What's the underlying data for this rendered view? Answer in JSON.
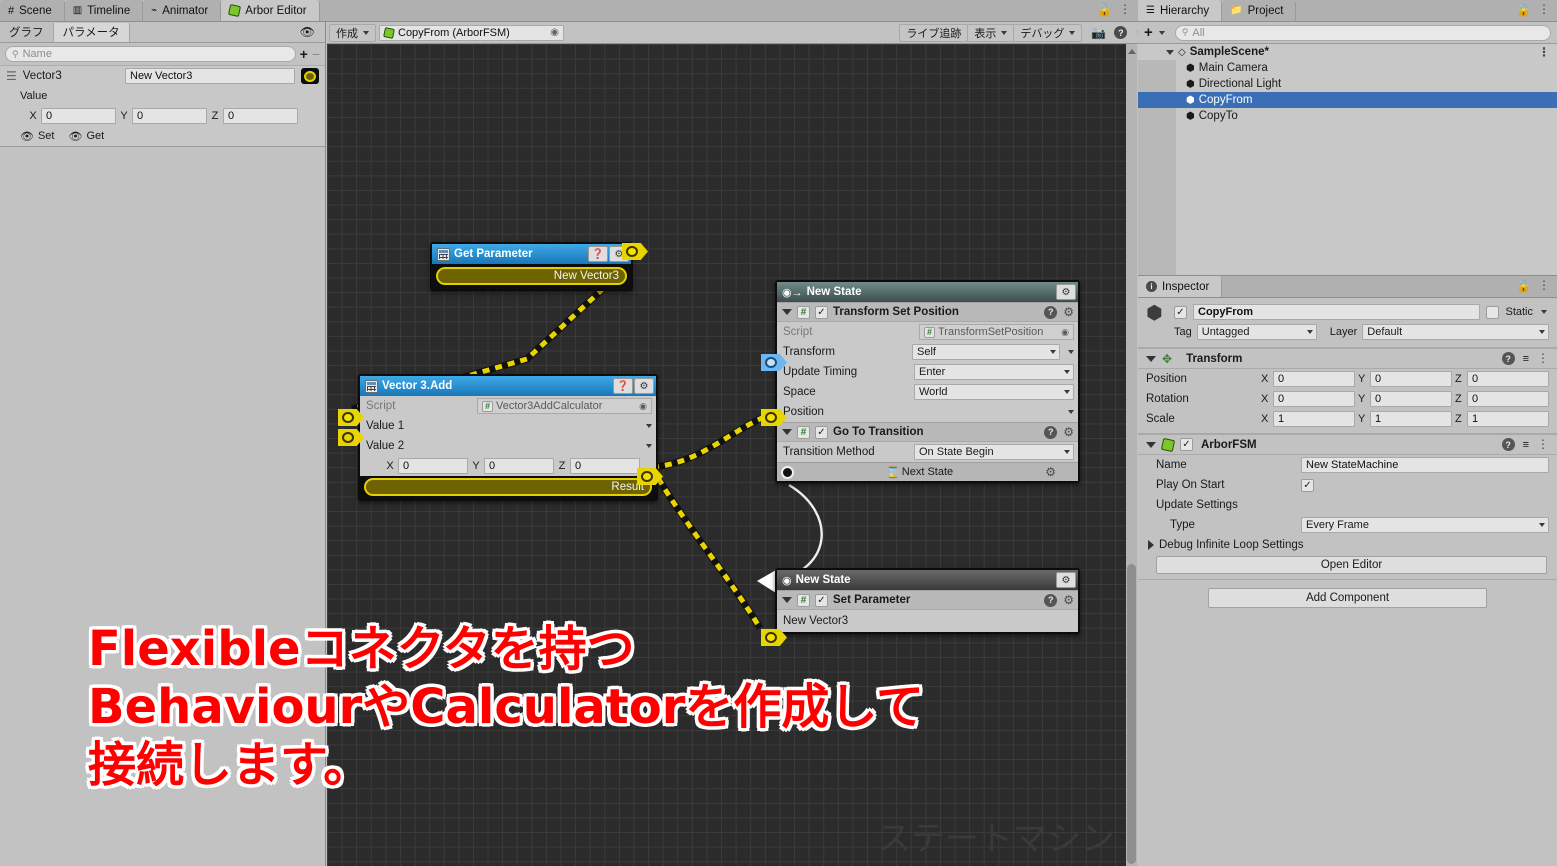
{
  "window": {
    "tabs": [
      {
        "label": "Scene",
        "icon": "grid-icon",
        "active": false
      },
      {
        "label": "Timeline",
        "icon": "film-icon",
        "active": false
      },
      {
        "label": "Animator",
        "icon": "animator-icon",
        "active": false
      },
      {
        "label": "Arbor Editor",
        "icon": "arbor-icon",
        "active": true
      }
    ],
    "lock_icon": "lock-icon",
    "menu_icon": "kebab-menu-icon"
  },
  "left_panel": {
    "tabs": [
      {
        "label": "グラフ",
        "active": false
      },
      {
        "label": "パラメータ",
        "active": true
      }
    ],
    "visibility_icon": "eye-icon",
    "search": {
      "placeholder": "Name",
      "icon": "search-icon"
    },
    "add_button": "+",
    "remove_button": "−",
    "parameter": {
      "drag_handle": "drag-handle-icon",
      "type": "Vector3",
      "name": "New Vector3",
      "connector_icon": "flexible-connector-icon",
      "value_label": "Value",
      "axes": [
        {
          "label": "X",
          "value": "0"
        },
        {
          "label": "Y",
          "value": "0"
        },
        {
          "label": "Z",
          "value": "0"
        }
      ],
      "set_label": "Set",
      "get_label": "Get"
    }
  },
  "graph_toolbar": {
    "create_label": "作成",
    "graph_field": {
      "value": "CopyFrom (ArborFSM)",
      "icon": "arbor-icon",
      "picker_icon": "target-icon"
    },
    "live_tracking": "ライブ追跡",
    "display": "表示",
    "debug": "デバッグ",
    "camera_icon": "camera-icon",
    "help_icon": "help-icon",
    "settings_icon": "gear-icon"
  },
  "canvas": {
    "watermark": "ステートマシン",
    "annotation": "Flexibleコネクタを持つ\nBehaviourやCalculatorを作成して\n接続します。",
    "annotation_color": "#ff0000"
  },
  "nodes": {
    "get_parameter": {
      "title": "Get Parameter",
      "icon": "calculator-icon",
      "help_icon": "help-icon",
      "gear_icon": "gear-icon",
      "output_slot": "New Vector3"
    },
    "vector3_add": {
      "title": "Vector 3.Add",
      "icon": "calculator-icon",
      "help_icon": "help-icon",
      "gear_icon": "gear-icon",
      "script_label": "Script",
      "script_value": "Vector3AddCalculator",
      "rows": [
        {
          "label": "Value 1"
        },
        {
          "label": "Value 2"
        }
      ],
      "axes": [
        {
          "label": "X",
          "value": "0"
        },
        {
          "label": "Y",
          "value": "0"
        },
        {
          "label": "Z",
          "value": "0"
        }
      ],
      "result_label": "Result"
    },
    "state_transform": {
      "title": "New State",
      "title_icon": "state-start-icon",
      "gear_icon": "gear-icon",
      "behaviour": {
        "title": "Transform Set Position",
        "hash": "#",
        "enabled": true,
        "help_icon": "help-icon",
        "gear_icon": "gear-icon",
        "fields": [
          {
            "label": "Script",
            "value": "TransformSetPosition",
            "readonly": true
          },
          {
            "label": "Transform",
            "value": "Self",
            "type": "dropdown_flex"
          },
          {
            "label": "Update Timing",
            "value": "Enter",
            "type": "dropdown"
          },
          {
            "label": "Space",
            "value": "World",
            "type": "dropdown"
          },
          {
            "label": "Position",
            "value": "",
            "type": "flex_only"
          }
        ]
      },
      "transition": {
        "title": "Go To Transition",
        "hash": "#",
        "enabled": true,
        "help_icon": "help-icon",
        "gear_icon": "gear-icon",
        "method_label": "Transition Method",
        "method_value": "On State Begin",
        "next_state_label": "Next State",
        "next_state_icon": "timer-icon",
        "next_state_gear": "gear-icon"
      }
    },
    "state_setparam": {
      "title": "New State",
      "title_icon": "state-circle-icon",
      "gear_icon": "gear-icon",
      "behaviour": {
        "title": "Set Parameter",
        "hash": "#",
        "enabled": true,
        "help_icon": "help-icon",
        "gear_icon": "gear-icon",
        "param_label": "New Vector3"
      }
    }
  },
  "hierarchy": {
    "tabs": [
      {
        "label": "Hierarchy",
        "icon": "hierarchy-icon",
        "active": true
      },
      {
        "label": "Project",
        "icon": "folder-icon",
        "active": false
      }
    ],
    "add_label": "+",
    "search": {
      "placeholder": "All",
      "icon": "search-icon"
    },
    "items": [
      {
        "label": "SampleScene*",
        "icon": "scene-icon",
        "depth": 0,
        "selected": false,
        "bold": true,
        "expander": true
      },
      {
        "label": "Main Camera",
        "icon": "gameobject-icon",
        "depth": 1,
        "selected": false
      },
      {
        "label": "Directional Light",
        "icon": "gameobject-icon",
        "depth": 1,
        "selected": false
      },
      {
        "label": "CopyFrom",
        "icon": "gameobject-icon",
        "depth": 1,
        "selected": true
      },
      {
        "label": "CopyTo",
        "icon": "gameobject-icon",
        "depth": 1,
        "selected": false
      }
    ]
  },
  "inspector": {
    "tab_label": "Inspector",
    "tab_icon": "info-icon",
    "lock_icon": "lock-icon",
    "menu_icon": "kebab-menu-icon",
    "gameobject": {
      "icon": "gameobject-icon",
      "enabled": true,
      "name": "CopyFrom",
      "static_label": "Static",
      "static_checked": false,
      "tag_label": "Tag",
      "tag_value": "Untagged",
      "layer_label": "Layer",
      "layer_value": "Default"
    },
    "transform": {
      "title": "Transform",
      "icon": "transform-icon",
      "help_icon": "help-icon",
      "preset_icon": "preset-icon",
      "menu_icon": "kebab-menu-icon",
      "rows": [
        {
          "label": "Position",
          "x": "0",
          "y": "0",
          "z": "0"
        },
        {
          "label": "Rotation",
          "x": "0",
          "y": "0",
          "z": "0"
        },
        {
          "label": "Scale",
          "x": "1",
          "y": "1",
          "z": "1"
        }
      ]
    },
    "arborfsm": {
      "title": "ArborFSM",
      "icon": "arbor-icon",
      "enabled": true,
      "help_icon": "help-icon",
      "preset_icon": "preset-icon",
      "menu_icon": "kebab-menu-icon",
      "name_label": "Name",
      "name_value": "New StateMachine",
      "play_on_start_label": "Play On Start",
      "play_on_start_checked": true,
      "update_settings_label": "Update Settings",
      "type_label": "Type",
      "type_value": "Every Frame",
      "debug_label": "Debug Infinite Loop Settings",
      "open_editor_label": "Open Editor"
    },
    "add_component_label": "Add Component"
  }
}
